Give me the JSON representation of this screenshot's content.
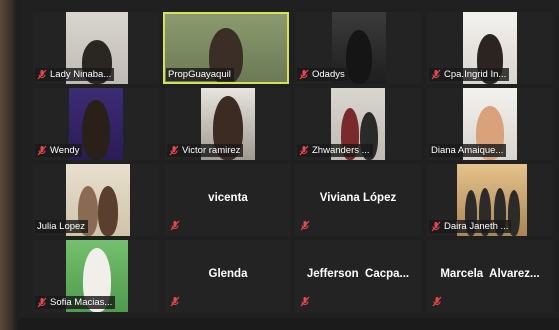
{
  "window": {
    "app": "Zoom meeting - gallery view"
  },
  "participants": [
    {
      "name": "Lady Ninaba...",
      "video": true,
      "muted": true,
      "active": false,
      "bg": "bg-wall-light"
    },
    {
      "name": "PropGuayaquil",
      "video": true,
      "muted": false,
      "active": true,
      "bg": "bg-wall-green"
    },
    {
      "name": "Odadys",
      "video": true,
      "muted": true,
      "active": false,
      "bg": "bg-dark"
    },
    {
      "name": "Cpa.Ingrid In...",
      "video": true,
      "muted": true,
      "active": false,
      "bg": "bg-white"
    },
    {
      "name": "Wendy",
      "video": true,
      "muted": true,
      "active": false,
      "bg": "bg-purple"
    },
    {
      "name": "Victor ramirez",
      "video": true,
      "muted": true,
      "active": false,
      "bg": "bg-office"
    },
    {
      "name": "Zhwanders ...",
      "video": true,
      "muted": true,
      "active": false,
      "bg": "bg-wall-light"
    },
    {
      "name": "Diana Amaique...",
      "video": true,
      "muted": false,
      "active": false,
      "bg": "bg-white"
    },
    {
      "name": "Julia Lopez",
      "video": true,
      "muted": false,
      "active": false,
      "bg": "bg-beige"
    },
    {
      "name": "vicenta",
      "video": false,
      "muted": true,
      "active": false,
      "bg": ""
    },
    {
      "name": "Viviana López",
      "video": false,
      "muted": true,
      "active": false,
      "bg": ""
    },
    {
      "name": "Daira Janeth ...",
      "video": true,
      "muted": true,
      "active": false,
      "bg": "bg-sunset"
    },
    {
      "name": "Sofia Macias...",
      "video": true,
      "muted": true,
      "active": false,
      "bg": "bg-green"
    },
    {
      "name": "Glenda",
      "video": false,
      "muted": true,
      "active": false,
      "bg": ""
    },
    {
      "name": "Jefferson  Cacpa...",
      "video": false,
      "muted": true,
      "active": false,
      "bg": ""
    },
    {
      "name": "Marcela  Alvarez...",
      "video": false,
      "muted": true,
      "active": false,
      "bg": ""
    }
  ],
  "icons": {
    "muted": "mic-muted-icon"
  },
  "colors": {
    "active_border": "#d6e05a",
    "muted_red": "#e5484d",
    "tile_bg": "#232323"
  }
}
